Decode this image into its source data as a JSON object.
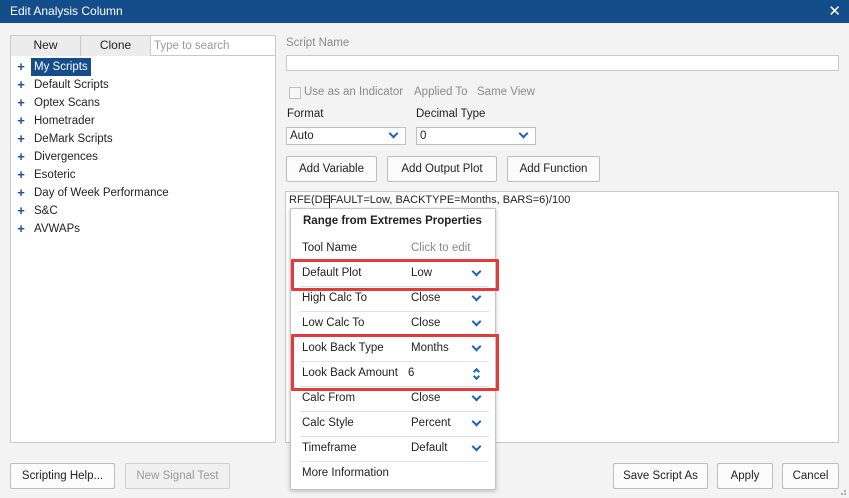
{
  "window": {
    "title": "Edit Analysis Column",
    "close_glyph": "✕"
  },
  "left": {
    "tabs": {
      "new": "New",
      "clone": "Clone"
    },
    "search_placeholder": "Type to search",
    "tree_items": [
      {
        "label": "My Scripts",
        "selected": true
      },
      {
        "label": "Default Scripts"
      },
      {
        "label": "Optex Scans"
      },
      {
        "label": "Hometrader"
      },
      {
        "label": "DeMark Scripts"
      },
      {
        "label": "Divergences"
      },
      {
        "label": "Esoteric"
      },
      {
        "label": "Day of Week Performance"
      },
      {
        "label": "S&C"
      },
      {
        "label": "AVWAPs"
      }
    ],
    "expand_glyph": "+"
  },
  "form": {
    "script_name_label": "Script Name",
    "script_name_value": "",
    "use_as_indicator_label": "Use as an Indicator",
    "use_as_indicator_checked": false,
    "applied_to_label": "Applied To",
    "applied_to_value": "Same View",
    "format_label": "Format",
    "format_value": "Auto",
    "decimal_type_label": "Decimal Type",
    "decimal_type_value": "0"
  },
  "buttons": {
    "add_variable": "Add Variable",
    "add_output_plot": "Add Output Plot",
    "add_function": "Add Function",
    "scripting_help": "Scripting Help...",
    "new_signal_test": "New Signal Test",
    "save_script_as": "Save Script As",
    "apply": "Apply",
    "cancel": "Cancel"
  },
  "editor": {
    "code": "RFE(DEFAULT=Low, BACKTYPE=Months, BARS=6)/100"
  },
  "popup": {
    "title": "Range from Extremes Properties",
    "rows": [
      {
        "name": "Tool Name",
        "value": "Click to edit",
        "control": "text"
      },
      {
        "name": "Default Plot",
        "value": "Low",
        "control": "dropdown"
      },
      {
        "name": "High Calc To",
        "value": "Close",
        "control": "dropdown"
      },
      {
        "name": "Low Calc To",
        "value": "Close",
        "control": "dropdown"
      },
      {
        "name": "Look Back Type",
        "value": "Months",
        "control": "dropdown"
      },
      {
        "name": "Look Back Amount",
        "value": "6",
        "control": "spinner"
      },
      {
        "name": "Calc From",
        "value": "Close",
        "control": "dropdown"
      },
      {
        "name": "Calc Style",
        "value": "Percent",
        "control": "dropdown"
      },
      {
        "name": "Timeframe",
        "value": "Default",
        "control": "dropdown"
      },
      {
        "name": "More Information",
        "value": "",
        "control": "link"
      }
    ]
  },
  "colors": {
    "title_bar": "#134d8a",
    "selection": "#134d8a",
    "chevron": "#1c62b9",
    "highlight_border": "#e23b3b"
  }
}
